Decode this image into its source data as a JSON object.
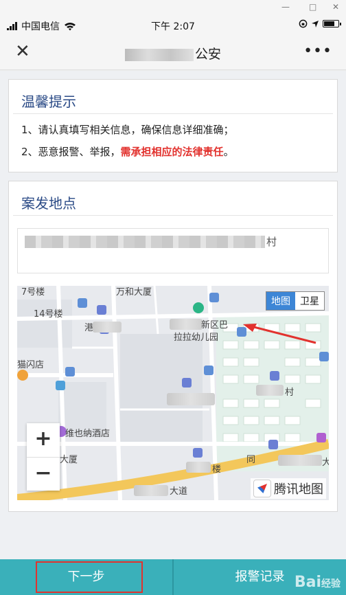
{
  "status": {
    "carrier": "中国电信",
    "time": "下午 2:07"
  },
  "nav": {
    "close_icon": "close-icon",
    "title_suffix": "公安",
    "more_icon": "more-icon"
  },
  "tips": {
    "title": "温馨提示",
    "line1": "1、请认真填写相关信息，确保信息详细准确；",
    "line2_prefix": "2、恶意报警、举报，",
    "line2_warn": "需承担相应的法律责任",
    "line2_suffix": "。",
    "warn_color": "#e2322e"
  },
  "location": {
    "title": "案发地点",
    "address_end": "村"
  },
  "map": {
    "type_map": "地图",
    "type_satellite": "卫星",
    "zoom_in": "+",
    "zoom_out": "−",
    "brand": "腾讯地图",
    "labels": {
      "wanhe": "万和大厦",
      "bldg14": "14号楼",
      "bldg7": "7号楼",
      "xinqu": "新区巴",
      "kindergarten": "拉拉幼儿园",
      "maoshan": "猫闪店",
      "vienna": "维也纳酒店",
      "dasha": "大厦",
      "cun": "村",
      "lou": "楼",
      "tong": "同",
      "da": "大",
      "dao": "大道",
      "gang": "港"
    }
  },
  "bottom": {
    "next": "下一步",
    "records": "报警记录"
  },
  "watermark": {
    "text": "Bai",
    "sub": "经验"
  },
  "colors": {
    "accent": "#3ab0ba",
    "title_blue": "#2a4a86",
    "map_toggle": "#3d86d6"
  }
}
